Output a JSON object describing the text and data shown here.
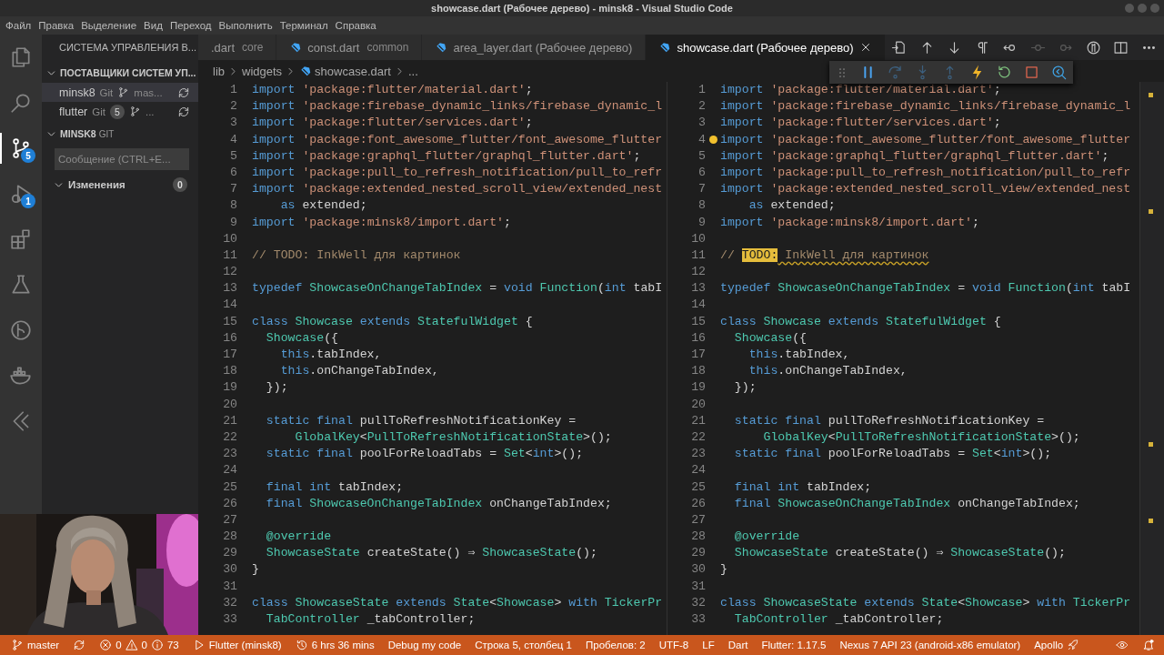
{
  "window": {
    "title": "showcase.dart (Рабочее дерево) - minsk8 - Visual Studio Code"
  },
  "menu": [
    "Файл",
    "Правка",
    "Выделение",
    "Вид",
    "Переход",
    "Выполнить",
    "Терминал",
    "Справка"
  ],
  "activity_bar": [
    {
      "selected": false
    },
    {
      "selected": false
    },
    {
      "selected": true,
      "badge": "5"
    },
    {
      "selected": false,
      "badge": "1"
    },
    {
      "selected": false
    },
    {
      "selected": false
    },
    {
      "selected": false
    },
    {
      "selected": false
    },
    {
      "selected": false
    }
  ],
  "sidebar": {
    "title": "СИСТЕМА УПРАВЛЕНИЯ В...",
    "providers": {
      "title": "ПОСТАВЩИКИ СИСТЕМ УП...",
      "expanded": true,
      "repos": [
        {
          "name": "minsk8",
          "type": "Git",
          "branch": "mas...",
          "selected": true
        },
        {
          "name": "flutter",
          "type": "Git",
          "badge": "5",
          "branch": "...",
          "selected": false
        }
      ]
    },
    "repo_section": {
      "title": "MINSK8",
      "type": "GIT"
    },
    "commit_message": {
      "placeholder": "Сообщение (CTRL+E..."
    },
    "changes": {
      "title": "Изменения",
      "expanded": true,
      "count": "0"
    }
  },
  "tabs": [
    {
      "name": ".dart",
      "detail": "core",
      "icon": false,
      "selected": false
    },
    {
      "name": "const.dart",
      "detail": "common",
      "icon": true,
      "selected": false
    },
    {
      "name": "area_layer.dart (Рабочее дерево)",
      "icon": true,
      "selected": false
    },
    {
      "name": "showcase.dart (Рабочее дерево)",
      "icon": true,
      "selected": true
    }
  ],
  "editor_actions": [
    {
      "disabled": false
    },
    {
      "disabled": false
    },
    {
      "disabled": false
    },
    {
      "disabled": false
    },
    {
      "disabled": false
    },
    {
      "disabled": true
    },
    {
      "disabled": true
    },
    {
      "disabled": false
    },
    {
      "disabled": false
    },
    {
      "disabled": false
    }
  ],
  "breadcrumb": [
    "lib",
    "widgets",
    "showcase.dart",
    "..."
  ],
  "debug_toolbar": [
    {
      "disabled": false
    },
    {
      "disabled": true
    },
    {
      "disabled": true
    },
    {
      "disabled": true
    },
    {
      "disabled": false
    },
    {
      "disabled": false
    },
    {
      "disabled": false
    },
    {
      "disabled": false
    }
  ],
  "panes": [
    {
      "lines": [
        {
          "n": "1",
          "tokens": [
            {
              "kind": "k",
              "text": "import "
            },
            {
              "kind": "s",
              "text": "'package:flutter/material.dart'"
            },
            {
              "kind": "p",
              "text": ";"
            }
          ]
        },
        {
          "n": "2",
          "tokens": [
            {
              "kind": "k",
              "text": "import "
            },
            {
              "kind": "s",
              "text": "'package:firebase_dynamic_links/firebase_dynamic_l"
            }
          ]
        },
        {
          "n": "3",
          "tokens": [
            {
              "kind": "k",
              "text": "import "
            },
            {
              "kind": "s",
              "text": "'package:flutter/services.dart'"
            },
            {
              "kind": "p",
              "text": ";"
            }
          ]
        },
        {
          "n": "4",
          "tokens": [
            {
              "kind": "k",
              "text": "import "
            },
            {
              "kind": "s",
              "text": "'package:font_awesome_flutter/font_awesome_flutter"
            }
          ]
        },
        {
          "n": "5",
          "tokens": [
            {
              "kind": "k",
              "text": "import "
            },
            {
              "kind": "s",
              "text": "'package:graphql_flutter/graphql_flutter.dart'"
            },
            {
              "kind": "p",
              "text": ";"
            }
          ]
        },
        {
          "n": "6",
          "tokens": [
            {
              "kind": "k",
              "text": "import "
            },
            {
              "kind": "s",
              "text": "'package:pull_to_refresh_notification/pull_to_refr"
            }
          ]
        },
        {
          "n": "7",
          "tokens": [
            {
              "kind": "k",
              "text": "import "
            },
            {
              "kind": "s",
              "text": "'package:extended_nested_scroll_view/extended_nest"
            }
          ]
        },
        {
          "n": "8",
          "tokens": [
            {
              "kind": "k",
              "text": "    as "
            },
            {
              "kind": "p",
              "text": "extended;"
            }
          ]
        },
        {
          "n": "9",
          "tokens": [
            {
              "kind": "k",
              "text": "import "
            },
            {
              "kind": "s",
              "text": "'package:minsk8/import.dart'"
            },
            {
              "kind": "p",
              "text": ";"
            }
          ]
        },
        {
          "n": "10"
        },
        {
          "n": "11",
          "tokens": [
            {
              "kind": "c",
              "text": "// TODO: InkWell для картинок"
            }
          ]
        },
        {
          "n": "12"
        },
        {
          "n": "13",
          "tokens": [
            {
              "kind": "k",
              "text": "typedef "
            },
            {
              "kind": "t",
              "text": "ShowcaseOnChangeTabIndex"
            },
            {
              "kind": "p",
              "text": " = "
            },
            {
              "kind": "k",
              "text": "void "
            },
            {
              "kind": "t",
              "text": "Function"
            },
            {
              "kind": "p",
              "text": "("
            },
            {
              "kind": "k",
              "text": "int "
            },
            {
              "kind": "p",
              "text": "tabI"
            }
          ]
        },
        {
          "n": "14"
        },
        {
          "n": "15",
          "tokens": [
            {
              "kind": "k",
              "text": "class "
            },
            {
              "kind": "t",
              "text": "Showcase "
            },
            {
              "kind": "k",
              "text": "extends "
            },
            {
              "kind": "t",
              "text": "StatefulWidget"
            },
            {
              "kind": "p",
              "text": " {"
            }
          ]
        },
        {
          "n": "16",
          "tokens": [
            {
              "kind": "t",
              "text": "  Showcase"
            },
            {
              "kind": "p",
              "text": "({"
            }
          ]
        },
        {
          "n": "17",
          "tokens": [
            {
              "kind": "k",
              "text": "    this"
            },
            {
              "kind": "p",
              "text": ".tabIndex,"
            }
          ]
        },
        {
          "n": "18",
          "tokens": [
            {
              "kind": "k",
              "text": "    this"
            },
            {
              "kind": "p",
              "text": ".onChangeTabIndex,"
            }
          ]
        },
        {
          "n": "19",
          "tokens": [
            {
              "kind": "p",
              "text": "  });"
            }
          ]
        },
        {
          "n": "20"
        },
        {
          "n": "21",
          "tokens": [
            {
              "kind": "k",
              "text": "  static final "
            },
            {
              "kind": "p",
              "text": "pullToRefreshNotificationKey ="
            }
          ]
        },
        {
          "n": "22",
          "tokens": [
            {
              "kind": "t",
              "text": "      GlobalKey"
            },
            {
              "kind": "p",
              "text": "<"
            },
            {
              "kind": "t",
              "text": "PullToRefreshNotificationState"
            },
            {
              "kind": "p",
              "text": ">();"
            }
          ]
        },
        {
          "n": "23",
          "tokens": [
            {
              "kind": "k",
              "text": "  static final "
            },
            {
              "kind": "p",
              "text": "poolForReloadTabs = "
            },
            {
              "kind": "t",
              "text": "Set"
            },
            {
              "kind": "p",
              "text": "<"
            },
            {
              "kind": "k",
              "text": "int"
            },
            {
              "kind": "p",
              "text": ">();"
            }
          ]
        },
        {
          "n": "24"
        },
        {
          "n": "25",
          "tokens": [
            {
              "kind": "k",
              "text": "  final int "
            },
            {
              "kind": "p",
              "text": "tabIndex;"
            }
          ]
        },
        {
          "n": "26",
          "tokens": [
            {
              "kind": "k",
              "text": "  final "
            },
            {
              "kind": "t",
              "text": "ShowcaseOnChangeTabIndex "
            },
            {
              "kind": "p",
              "text": "onChangeTabIndex;"
            }
          ]
        },
        {
          "n": "27"
        },
        {
          "n": "28",
          "tokens": [
            {
              "kind": "t",
              "text": "  @override"
            }
          ]
        },
        {
          "n": "29",
          "tokens": [
            {
              "kind": "t",
              "text": "  ShowcaseState "
            },
            {
              "kind": "p",
              "text": "createState() ⇒ "
            },
            {
              "kind": "t",
              "text": "ShowcaseState"
            },
            {
              "kind": "p",
              "text": "();"
            }
          ]
        },
        {
          "n": "30",
          "tokens": [
            {
              "kind": "p",
              "text": "}"
            }
          ]
        },
        {
          "n": "31"
        },
        {
          "n": "32",
          "tokens": [
            {
              "kind": "k",
              "text": "class "
            },
            {
              "kind": "t",
              "text": "ShowcaseState "
            },
            {
              "kind": "k",
              "text": "extends "
            },
            {
              "kind": "t",
              "text": "State"
            },
            {
              "kind": "p",
              "text": "<"
            },
            {
              "kind": "t",
              "text": "Showcase"
            },
            {
              "kind": "p",
              "text": "> "
            },
            {
              "kind": "k",
              "text": "with "
            },
            {
              "kind": "t",
              "text": "TickerPr"
            }
          ]
        },
        {
          "n": "33",
          "tokens": [
            {
              "kind": "t",
              "text": "  TabController "
            },
            {
              "kind": "p",
              "text": "_tabController;"
            }
          ]
        }
      ]
    },
    {
      "lines": [
        {
          "n": "1",
          "tokens": [
            {
              "kind": "k",
              "text": "import "
            },
            {
              "kind": "s",
              "text": "'package:flutter/material.dart'"
            },
            {
              "kind": "p",
              "text": ";"
            }
          ]
        },
        {
          "n": "2",
          "tokens": [
            {
              "kind": "k",
              "text": "import "
            },
            {
              "kind": "s",
              "text": "'package:firebase_dynamic_links/firebase_dynamic_l"
            }
          ]
        },
        {
          "n": "3",
          "tokens": [
            {
              "kind": "k",
              "text": "import "
            },
            {
              "kind": "s",
              "text": "'package:flutter/services.dart'"
            },
            {
              "kind": "p",
              "text": ";"
            }
          ]
        },
        {
          "n": "4",
          "lightbulb": true,
          "tokens": [
            {
              "kind": "k",
              "text": "import "
            },
            {
              "kind": "s",
              "text": "'package:font_awesome_flutter/font_awesome_flutter"
            }
          ]
        },
        {
          "n": "5",
          "tokens": [
            {
              "kind": "k",
              "text": "import "
            },
            {
              "kind": "s",
              "text": "'package:graphql_flutter/graphql_flutter.dart'"
            },
            {
              "kind": "p",
              "text": ";"
            }
          ]
        },
        {
          "n": "6",
          "tokens": [
            {
              "kind": "k",
              "text": "import "
            },
            {
              "kind": "s",
              "text": "'package:pull_to_refresh_notification/pull_to_refr"
            }
          ]
        },
        {
          "n": "7",
          "tokens": [
            {
              "kind": "k",
              "text": "import "
            },
            {
              "kind": "s",
              "text": "'package:extended_nested_scroll_view/extended_nest"
            }
          ]
        },
        {
          "n": "8",
          "tokens": [
            {
              "kind": "k",
              "text": "    as "
            },
            {
              "kind": "p",
              "text": "extended;"
            }
          ]
        },
        {
          "n": "9",
          "tokens": [
            {
              "kind": "k",
              "text": "import "
            },
            {
              "kind": "s",
              "text": "'package:minsk8/import.dart'"
            },
            {
              "kind": "p",
              "text": ";"
            }
          ]
        },
        {
          "n": "10"
        },
        {
          "n": "11",
          "tokens": [
            {
              "kind": "c",
              "text": "// "
            },
            {
              "kind": "todo",
              "text": "TODO:"
            },
            {
              "kind": "w",
              "text": " InkWell для картинок"
            }
          ]
        },
        {
          "n": "12"
        },
        {
          "n": "13",
          "tokens": [
            {
              "kind": "k",
              "text": "typedef "
            },
            {
              "kind": "t",
              "text": "ShowcaseOnChangeTabIndex"
            },
            {
              "kind": "p",
              "text": " = "
            },
            {
              "kind": "k",
              "text": "void "
            },
            {
              "kind": "t",
              "text": "Function"
            },
            {
              "kind": "p",
              "text": "("
            },
            {
              "kind": "k",
              "text": "int "
            },
            {
              "kind": "p",
              "text": "tabI"
            }
          ]
        },
        {
          "n": "14"
        },
        {
          "n": "15",
          "tokens": [
            {
              "kind": "k",
              "text": "class "
            },
            {
              "kind": "t",
              "text": "Showcase "
            },
            {
              "kind": "k",
              "text": "extends "
            },
            {
              "kind": "t",
              "text": "StatefulWidget"
            },
            {
              "kind": "p",
              "text": " {"
            }
          ]
        },
        {
          "n": "16",
          "tokens": [
            {
              "kind": "t",
              "text": "  Showcase"
            },
            {
              "kind": "p",
              "text": "({"
            }
          ]
        },
        {
          "n": "17",
          "tokens": [
            {
              "kind": "k",
              "text": "    this"
            },
            {
              "kind": "p",
              "text": ".tabIndex,"
            }
          ]
        },
        {
          "n": "18",
          "tokens": [
            {
              "kind": "k",
              "text": "    this"
            },
            {
              "kind": "p",
              "text": ".onChangeTabIndex,"
            }
          ]
        },
        {
          "n": "19",
          "tokens": [
            {
              "kind": "p",
              "text": "  });"
            }
          ]
        },
        {
          "n": "20"
        },
        {
          "n": "21",
          "tokens": [
            {
              "kind": "k",
              "text": "  static final "
            },
            {
              "kind": "p",
              "text": "pullToRefreshNotificationKey ="
            }
          ]
        },
        {
          "n": "22",
          "tokens": [
            {
              "kind": "t",
              "text": "      GlobalKey"
            },
            {
              "kind": "p",
              "text": "<"
            },
            {
              "kind": "t",
              "text": "PullToRefreshNotificationState"
            },
            {
              "kind": "p",
              "text": ">();"
            }
          ]
        },
        {
          "n": "23",
          "tokens": [
            {
              "kind": "k",
              "text": "  static final "
            },
            {
              "kind": "p",
              "text": "poolForReloadTabs = "
            },
            {
              "kind": "t",
              "text": "Set"
            },
            {
              "kind": "p",
              "text": "<"
            },
            {
              "kind": "k",
              "text": "int"
            },
            {
              "kind": "p",
              "text": ">();"
            }
          ]
        },
        {
          "n": "24"
        },
        {
          "n": "25",
          "tokens": [
            {
              "kind": "k",
              "text": "  final int "
            },
            {
              "kind": "p",
              "text": "tabIndex;"
            }
          ]
        },
        {
          "n": "26",
          "tokens": [
            {
              "kind": "k",
              "text": "  final "
            },
            {
              "kind": "t",
              "text": "ShowcaseOnChangeTabIndex "
            },
            {
              "kind": "p",
              "text": "onChangeTabIndex;"
            }
          ]
        },
        {
          "n": "27"
        },
        {
          "n": "28",
          "tokens": [
            {
              "kind": "t",
              "text": "  @override"
            }
          ]
        },
        {
          "n": "29",
          "tokens": [
            {
              "kind": "t",
              "text": "  ShowcaseState "
            },
            {
              "kind": "p",
              "text": "createState() ⇒ "
            },
            {
              "kind": "t",
              "text": "ShowcaseState"
            },
            {
              "kind": "p",
              "text": "();"
            }
          ]
        },
        {
          "n": "30",
          "tokens": [
            {
              "kind": "p",
              "text": "}"
            }
          ]
        },
        {
          "n": "31"
        },
        {
          "n": "32",
          "tokens": [
            {
              "kind": "k",
              "text": "class "
            },
            {
              "kind": "t",
              "text": "ShowcaseState "
            },
            {
              "kind": "k",
              "text": "extends "
            },
            {
              "kind": "t",
              "text": "State"
            },
            {
              "kind": "p",
              "text": "<"
            },
            {
              "kind": "t",
              "text": "Showcase"
            },
            {
              "kind": "p",
              "text": "> "
            },
            {
              "kind": "k",
              "text": "with "
            },
            {
              "kind": "t",
              "text": "TickerPr"
            }
          ]
        },
        {
          "n": "33",
          "tokens": [
            {
              "kind": "t",
              "text": "  TabController "
            },
            {
              "kind": "p",
              "text": "_tabController;"
            }
          ]
        }
      ]
    }
  ],
  "status_bar": [
    {
      "kind": "branch",
      "text": "master"
    },
    {
      "kind": "sync"
    },
    {
      "kind": "problems",
      "errors": "0",
      "warnings": "0",
      "infos": "73"
    },
    {
      "kind": "launch",
      "text": "Flutter (minsk8)"
    },
    {
      "kind": "timer",
      "text": "6 hrs 36 mins"
    },
    {
      "kind": "text",
      "text": "Debug my code"
    },
    {
      "kind": "text",
      "text": "Строка 5, столбец 1"
    },
    {
      "kind": "text",
      "text": "Пробелов: 2"
    },
    {
      "kind": "text",
      "text": "UTF-8"
    },
    {
      "kind": "text",
      "text": "LF"
    },
    {
      "kind": "text",
      "text": "Dart"
    },
    {
      "kind": "text",
      "text": "Flutter: 1.17.5"
    },
    {
      "kind": "text",
      "text": "Nexus 7 API 23 (android-x86 emulator)"
    },
    {
      "kind": "apollo",
      "text": "Apollo"
    },
    {
      "kind": "eye"
    },
    {
      "kind": "bell"
    }
  ],
  "webcam": {
    "kind": "picture"
  }
}
